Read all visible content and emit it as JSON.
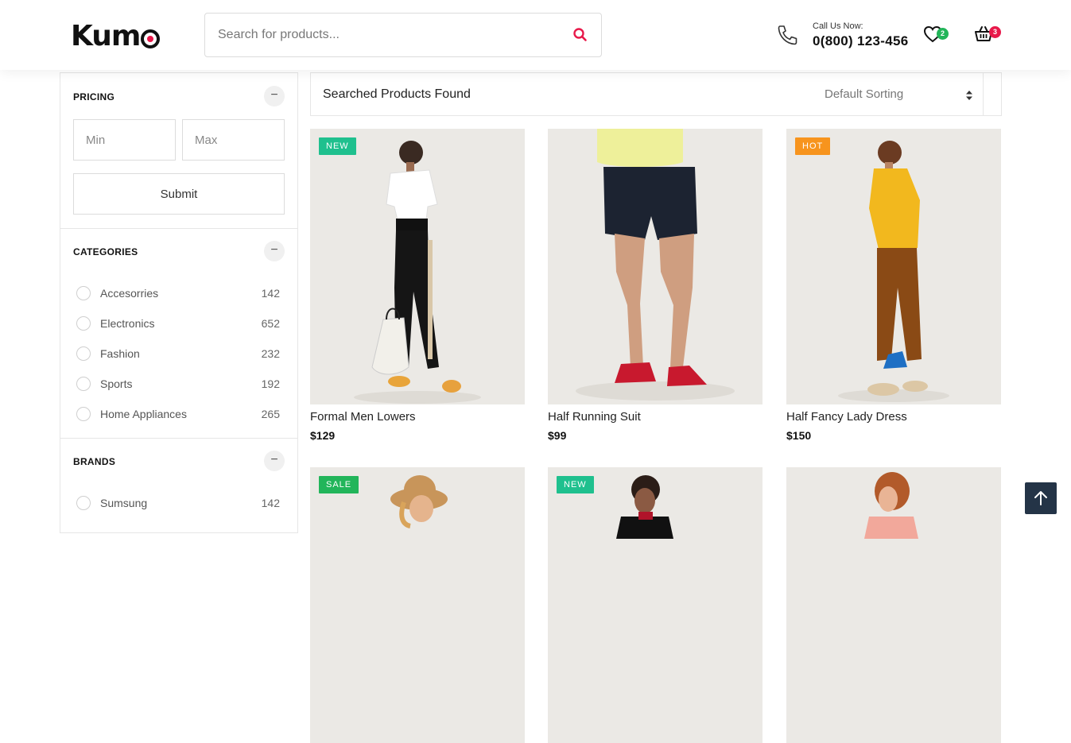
{
  "header": {
    "logo_text": "Kum",
    "search": {
      "placeholder": "Search for products..."
    },
    "call_label": "Call Us Now:",
    "call_number": "0(800) 123-456",
    "wishlist_count": "2",
    "cart_count": "3"
  },
  "sidebar": {
    "pricing": {
      "title": "PRICING",
      "min_placeholder": "Min",
      "max_placeholder": "Max",
      "submit_label": "Submit"
    },
    "categories": {
      "title": "CATEGORIES",
      "items": [
        {
          "label": "Accesorries",
          "count": "142"
        },
        {
          "label": "Electronics",
          "count": "652"
        },
        {
          "label": "Fashion",
          "count": "232"
        },
        {
          "label": "Sports",
          "count": "192"
        },
        {
          "label": "Home Appliances",
          "count": "265"
        }
      ]
    },
    "brands": {
      "title": "BRANDS",
      "items": [
        {
          "label": "Sumsung",
          "count": "142"
        }
      ]
    },
    "toggle_symbol": "−"
  },
  "results": {
    "title": "Searched Products Found",
    "sort_label": "Default Sorting"
  },
  "products": [
    {
      "name": "Formal Men Lowers",
      "price": "$129",
      "tag": "NEW"
    },
    {
      "name": "Half Running Suit",
      "price": "$99",
      "tag": ""
    },
    {
      "name": "Half Fancy Lady Dress",
      "price": "$150",
      "tag": "HOT"
    },
    {
      "name": "",
      "price": "",
      "tag": "SALE"
    },
    {
      "name": "",
      "price": "",
      "tag": "NEW"
    },
    {
      "name": "",
      "price": "",
      "tag": ""
    }
  ],
  "colors": {
    "accent": "#e8194a",
    "tag_new": "#1fc08e",
    "tag_hot": "#f7941d",
    "tag_sale": "#22b55a",
    "scroll_top_bg": "#243447",
    "image_bg": "#ebe9e5"
  },
  "icons": [
    "search-icon",
    "phone-icon",
    "heart-icon",
    "basket-icon",
    "minus-icon",
    "sort-arrows-icon",
    "arrow-up-icon"
  ]
}
